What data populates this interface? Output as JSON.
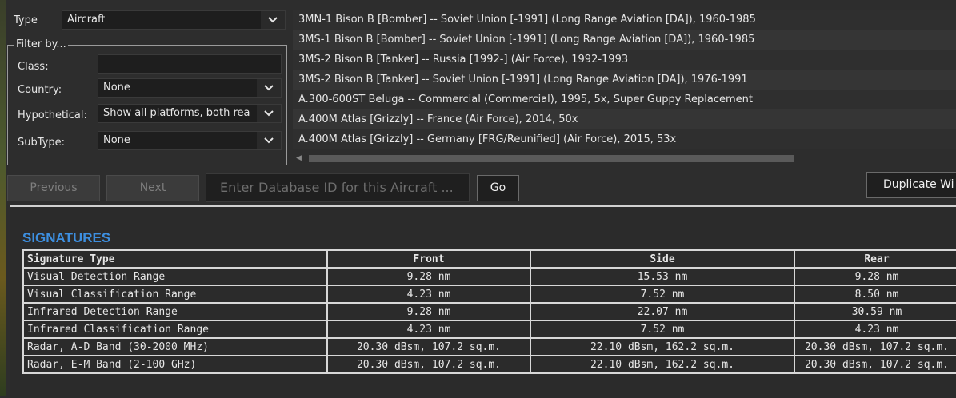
{
  "type_select": {
    "label": "Type",
    "value": "Aircraft"
  },
  "filter": {
    "legend": "Filter by...",
    "class_label": "Class:",
    "class_value": "",
    "country_label": "Country:",
    "country_value": "None",
    "hypothetical_label": "Hypothetical:",
    "hypothetical_value": "Show all platforms, both rea",
    "subtype_label": "SubType:",
    "subtype_value": "None"
  },
  "results": [
    "3MN-1 Bison B [Bomber] -- Soviet Union [-1991] (Long Range Aviation [DA]), 1960-1985",
    "3MS-1 Bison B [Bomber] -- Soviet Union [-1991] (Long Range Aviation [DA]), 1960-1985",
    "3MS-2 Bison B [Tanker] -- Russia [1992-] (Air Force), 1992-1993",
    "3MS-2 Bison B [Tanker] -- Soviet Union [-1991] (Long Range Aviation [DA]), 1976-1991",
    "A.300-600ST Beluga -- Commercial (Commercial), 1995, 5x, Super Guppy Replacement",
    "A.400M Atlas [Grizzly] -- France (Air Force), 2014, 50x",
    "A.400M Atlas [Grizzly] -- Germany [FRG/Reunified] (Air Force), 2015, 53x"
  ],
  "nav": {
    "previous": "Previous",
    "next": "Next",
    "db_placeholder": "Enter Database ID for this Aircraft ...",
    "go": "Go",
    "duplicate": "Duplicate Wi"
  },
  "signatures": {
    "title": "SIGNATURES",
    "headers": [
      "Signature Type",
      "Front",
      "Side",
      "Rear"
    ],
    "rows": [
      [
        "Visual Detection Range",
        "9.28 nm",
        "15.53 nm",
        "9.28 nm"
      ],
      [
        "Visual Classification Range",
        "4.23 nm",
        "7.52 nm",
        "8.50 nm"
      ],
      [
        "Infrared Detection Range",
        "9.28 nm",
        "22.07 nm",
        "30.59 nm"
      ],
      [
        "Infrared Classification Range",
        "4.23 nm",
        "7.52 nm",
        "4.23 nm"
      ],
      [
        "Radar, A-D Band (30-2000 MHz)",
        "20.30 dBsm, 107.2 sq.m.",
        "22.10 dBsm, 162.2 sq.m.",
        "20.30 dBsm, 107.2 sq.m."
      ],
      [
        "Radar, E-M Band (2-100 GHz)",
        "20.30 dBsm, 107.2 sq.m.",
        "22.10 dBsm, 162.2 sq.m.",
        "20.30 dBsm, 107.2 sq.m."
      ]
    ]
  },
  "icons": {
    "dropdown": "chevron-down-icon",
    "scroll_left": "arrow-left-icon"
  },
  "colors": {
    "accent": "#3d8fe0",
    "background": "#2d2d2d"
  }
}
